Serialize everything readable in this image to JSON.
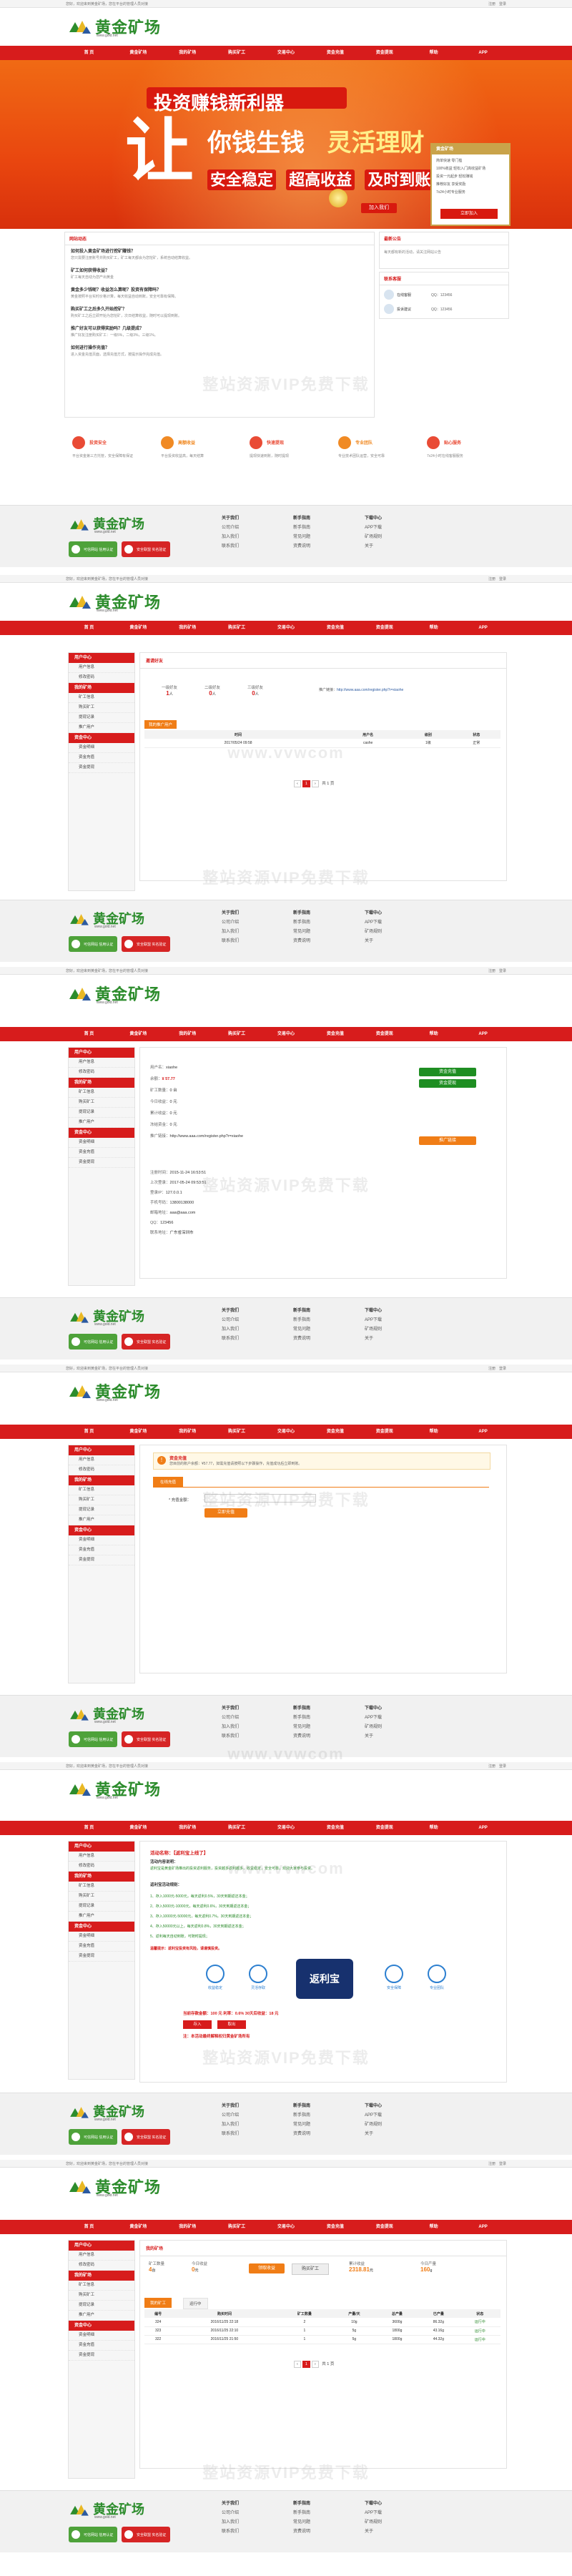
{
  "site": {
    "logo_text": "黄金矿场",
    "logo_url": "www.gold.net",
    "welcome": "您好，欢迎来到黄金矿场，您在平台的管理人员对接",
    "top_links": [
      "注册",
      "登录"
    ]
  },
  "nav": [
    "首 页",
    "黄金矿场",
    "我的矿场",
    "购买矿工",
    "交易中心",
    "资金充值",
    "资金提现",
    "帮助",
    "APP"
  ],
  "watermark": [
    "整站资源VIP免费下载",
    "www.vvwcom"
  ],
  "home": {
    "banner": {
      "line1": "投资赚钱新利器",
      "line2a": "你钱生钱",
      "line2b": "灵活理财",
      "line3a": "安全稳定",
      "line3b": "超高收益",
      "line3c": "及时到账",
      "big_char": "让",
      "join": "加入我们"
    },
    "promo": {
      "title": "黄金矿场",
      "lines": [
        "简单快速 零门槛",
        "100%收益 轻松入门高收益矿场",
        "投资一元起步 轻松赚钱",
        "推荐好友 享受奖励",
        "7x24小时专业服务"
      ],
      "button": "立即加入"
    },
    "faq_title": "网站动态",
    "faq": [
      {
        "q": "如何投入黄金矿场进行挖矿赚钱？",
        "a": "您只需要注册账号并购买矿工，矿工每天都会为您挖矿，系统自动结算收益。"
      },
      {
        "q": "矿工如何获得收益？",
        "a": "矿工每天自动为您产出黄金"
      },
      {
        "q": "黄金多少钱呢？收益怎么算呢？投资有保障吗？",
        "a": "黄金按照平台实时价格计算，每天收益自动到账，安全可靠有保障。"
      },
      {
        "q": "购买矿工之后多久开始挖矿？",
        "a": "购买矿工之后立即开始为您挖矿，次日结算收益，随时可以提现到账。"
      },
      {
        "q": "推广好友可以获得奖励吗？几级提成？",
        "a": "推广好友注册购买矿工：一级5%，二级3%，三级1%。"
      },
      {
        "q": "如何进行操作充值？",
        "a": "进入资金充值页面，选择充值方式，按提示操作完成充值。"
      }
    ],
    "notice_title": "最新公告",
    "notice_text": "每天都有新的活动，请关注网站公告",
    "service_title": "联系客服",
    "service": [
      {
        "name": "在线客服",
        "qq": "QQ：123456"
      },
      {
        "name": "投诉建议",
        "qq": "QQ：123456"
      }
    ],
    "features": [
      {
        "title": "投资安全",
        "desc": "平台资金第三方托管，安全保障有保证",
        "color": "#e94b35"
      },
      {
        "title": "高额收益",
        "desc": "平台投资收益高，每天结算",
        "color": "#f08a24"
      },
      {
        "title": "快速提现",
        "desc": "提现快速到账，随时提现",
        "color": "#e94b35"
      },
      {
        "title": "专业团队",
        "desc": "专业技术团队运营，安全可靠",
        "color": "#f08a24"
      },
      {
        "title": "贴心服务",
        "desc": "7x24小时在线客服服务",
        "color": "#e94b35"
      }
    ]
  },
  "footer": {
    "badges": [
      "可信网站 信用认证",
      "安全联盟 实名验证"
    ],
    "cols": [
      [
        "关于我们",
        "公司介绍",
        "加入我们",
        "联系我们"
      ],
      [
        "新手指南",
        "新手指南",
        "常见问题",
        "资费说明"
      ],
      [
        "下载中心",
        "APP下载",
        "矿场规则",
        "关于"
      ]
    ]
  },
  "sidebar": [
    "用户中心",
    "用户信息",
    "修改密码",
    "我的矿场",
    "矿工信息",
    "购买矿工",
    "提现记录",
    "推广用户",
    "资金中心",
    "资金明细",
    "资金充值",
    "资金提现"
  ],
  "invite": {
    "title": "邀请好友",
    "stats": [
      {
        "label": "一级好友",
        "value": "1",
        "unit": "人"
      },
      {
        "label": "二级好友",
        "value": "0",
        "unit": "人"
      },
      {
        "label": "三级好友",
        "value": "0",
        "unit": "人"
      }
    ],
    "link_label": "推广链接：",
    "link": "http://www.aaa.com/register.php?r=xiaohe",
    "list_title": "我的推广用户",
    "headers": [
      "时间",
      "用户名",
      "级别",
      "状态"
    ],
    "rows": [
      [
        "2017/05/24 09:58",
        "cashe",
        "1级",
        "正常"
      ]
    ],
    "pager": "共 1 页"
  },
  "profile": {
    "user_label": "用户名：",
    "user": "xiaohe",
    "balance_label": "余额：",
    "balance": "¥ 57.77",
    "miners_label": "矿工数量：",
    "miners": "0 台",
    "today_label": "今日收益：",
    "today": "0 元",
    "total_label": "累计收益：",
    "total": "0 元",
    "frozen_label": "冻结资金：",
    "frozen": "0 元",
    "link_label": "推广链接：",
    "link": "http://www.aaa.com/register.php?r=xiaohe",
    "buttons": [
      "资金充值",
      "资金提现",
      "推广链接"
    ],
    "reg_time_label": "注册时间：",
    "reg_time": "2015-11-24 16:53:51",
    "last_login_label": "上次登录：",
    "last_login": "2017-05-24 09:53:51",
    "ip_label": "登录IP：",
    "ip": "127.0.0.1",
    "phone_label": "手机号码：",
    "phone": "13800138000",
    "email_label": "邮箱地址：",
    "email": "aaa@aaa.com",
    "qq_label": "QQ：",
    "qq": "123456",
    "addr_label": "联系地址：",
    "addr": "广东省深圳市"
  },
  "recharge": {
    "title": "资金充值",
    "tip": "您目前的账户余额：¥57.77，如需充值请按照以下步骤操作，充值成功后立即到账。",
    "tab": "在线充值",
    "amount_label": "* 充值金额：",
    "amount_placeholder": "",
    "button": "立即充值"
  },
  "activity": {
    "title": "活动名称：【返利宝上线了】",
    "intro_title": "活动内容说明：",
    "intro": "返利宝是黄金矿场推出的投资返利服务，投资越多返利越多，收益稳定，安全可靠，欢迎大家参与投资。",
    "rule_title": "返利宝活动规则：",
    "rules": [
      "1、存入1000元-5000元，每天返利0.5%，30天到期返还本金；",
      "2、存入5000元-10000元，每天返利0.6%，30天到期返还本金；",
      "3、存入10000元-50000元，每天返利0.7%，30天到期返还本金；",
      "4、存入50000元以上，每天返利0.8%，30天到期返还本金；",
      "5、返利每天自动到账，可随时提现；"
    ],
    "notice": "温馨提示：返利宝投资有风险，请谨慎投资。",
    "logo_text": "返利宝",
    "icons": [
      "收益稳定",
      "灵活存取",
      "安全保障",
      "专业团队",
      "随时提现",
      "快速到账"
    ],
    "calc": "当前存款金额：100 元 利率：0.6% 30天后收益：18 元",
    "btn1": "存入",
    "btn2": "取出",
    "footer_note": "注：本活动最终解释权归黄金矿场所有"
  },
  "mymine": {
    "title": "我的矿场",
    "stats": [
      {
        "label": "矿工数量",
        "value": "4",
        "unit": "台"
      },
      {
        "label": "今日收益",
        "value": "0",
        "unit": "元"
      },
      {
        "label": "累计收益",
        "value": "2318.81",
        "unit": "元"
      },
      {
        "label": "今日产量",
        "value": "160",
        "unit": "g"
      }
    ],
    "btn1": "领取收益",
    "btn2": "购买矿工",
    "tab1": "我的矿工",
    "tab2": "运行中",
    "headers": [
      "编号",
      "购买时间",
      "矿工数量",
      "产量/天",
      "总产量",
      "已产量",
      "状态"
    ],
    "rows": [
      [
        "324",
        "2016/11/25 22:18",
        "2",
        "10g",
        "3600g",
        "86.32g",
        "运行中"
      ],
      [
        "323",
        "2016/11/25 22:10",
        "1",
        "5g",
        "1800g",
        "43.16g",
        "运行中"
      ],
      [
        "322",
        "2016/11/25 21:50",
        "1",
        "5g",
        "1800g",
        "44.32g",
        "运行中"
      ]
    ],
    "pager": "共 1 页"
  }
}
